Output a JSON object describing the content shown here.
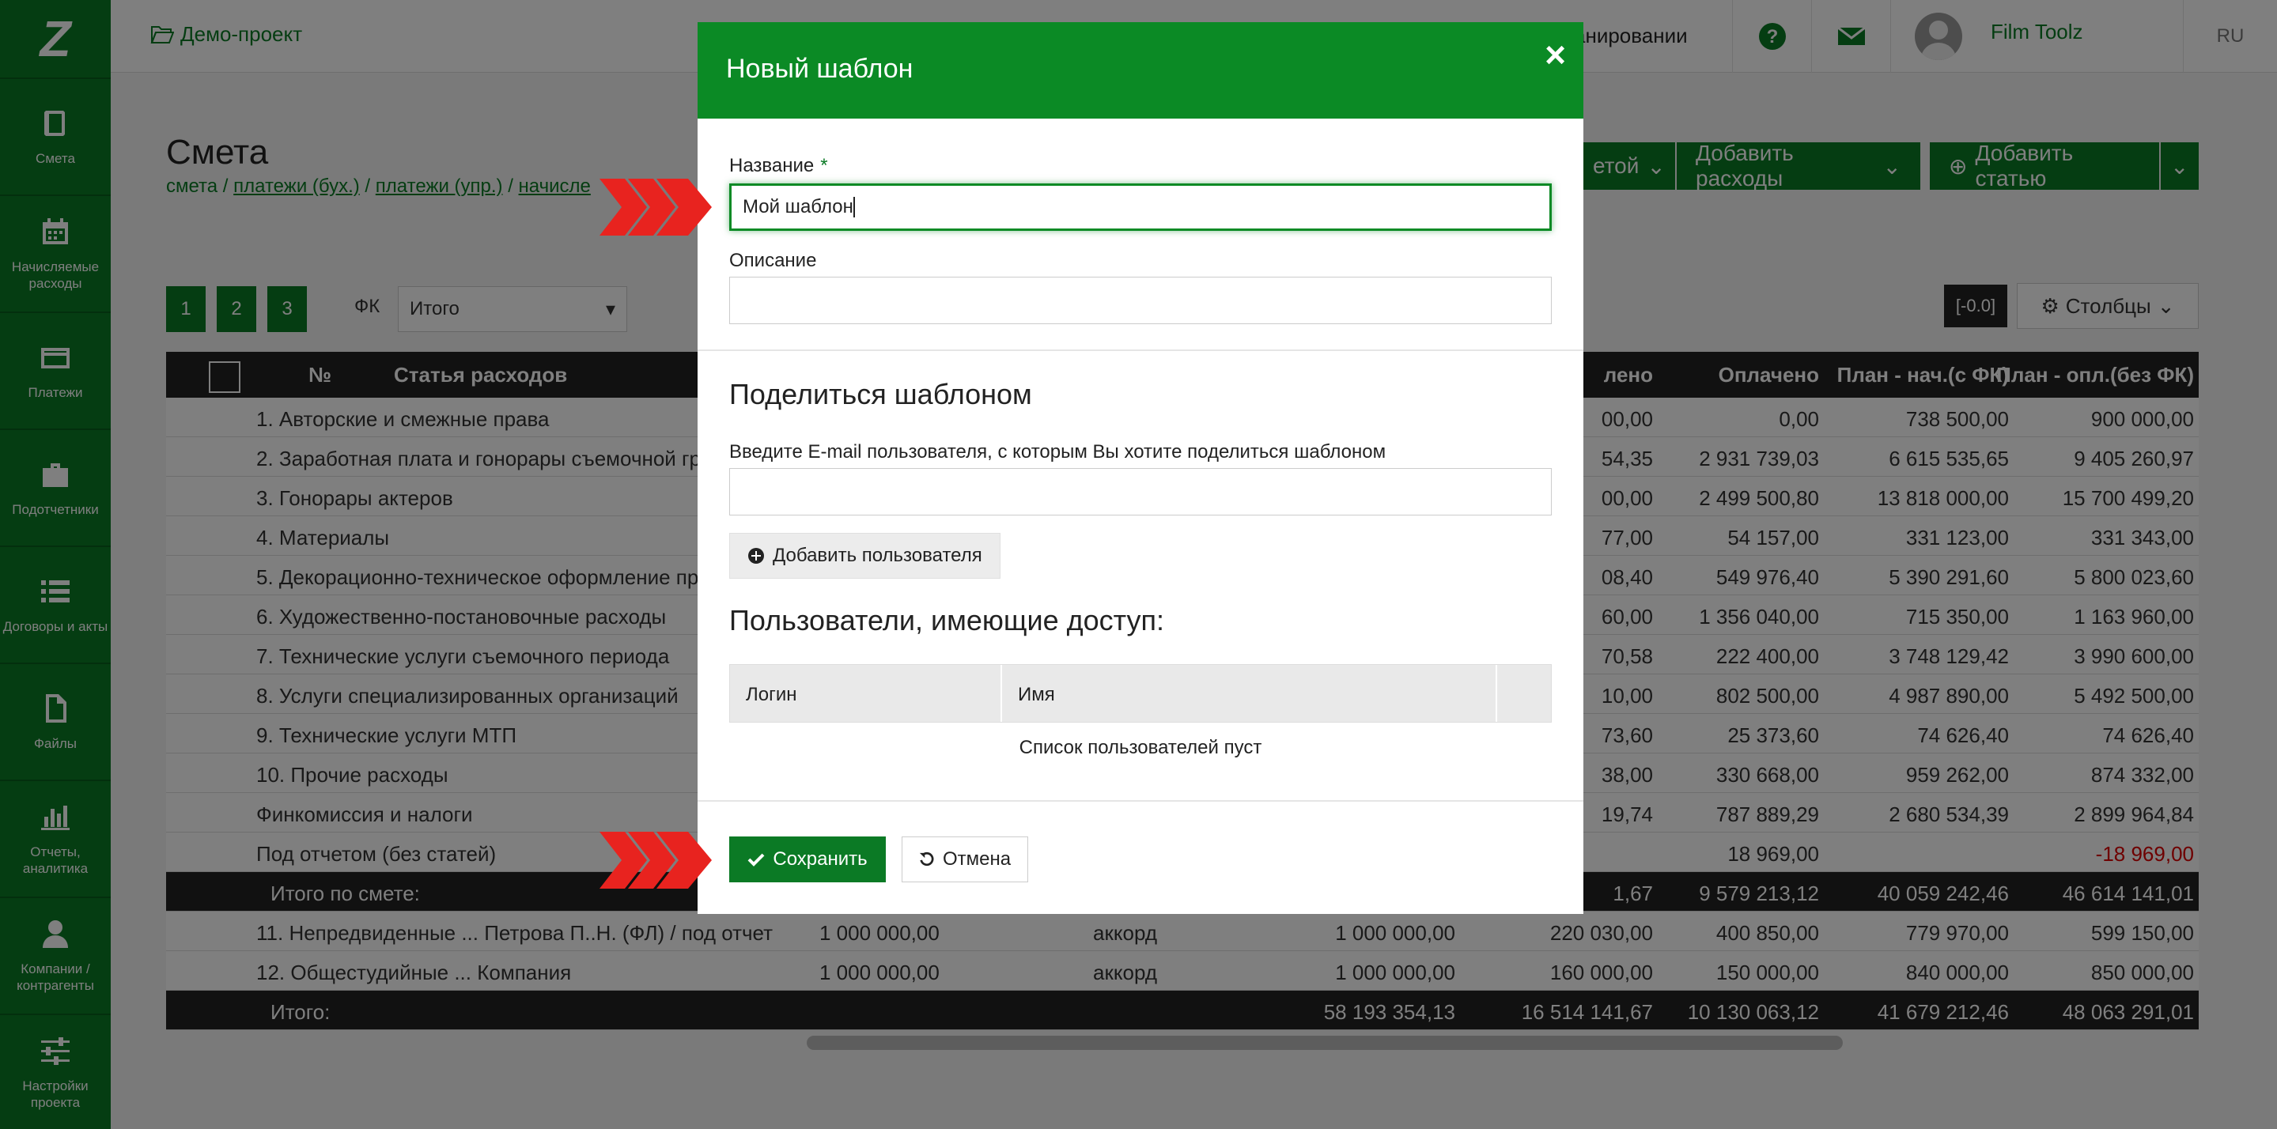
{
  "sidebar": {
    "logo": "Z",
    "items": [
      {
        "label": "Смета",
        "icon": "book-icon"
      },
      {
        "label": "Начисляемые расходы",
        "icon": "calendar-icon"
      },
      {
        "label": "Платежи",
        "icon": "card-icon"
      },
      {
        "label": "Подотчетники",
        "icon": "briefcase-icon"
      },
      {
        "label": "Договоры и акты",
        "icon": "list-icon"
      },
      {
        "label": "Файлы",
        "icon": "file-icon"
      },
      {
        "label": "Отчеты, аналитика",
        "icon": "bar-chart-icon"
      },
      {
        "label": "Компании / контрагенты",
        "icon": "user-icon"
      },
      {
        "label": "Настройки проекта",
        "icon": "sliders-icon"
      }
    ]
  },
  "topbar": {
    "project": "Демо-проект",
    "planning_fragment": "анировании",
    "user_name": "Film Toolz",
    "lang": "RU"
  },
  "page": {
    "title": "Смета",
    "breadcrumb": [
      "смета",
      "платежи (бух.)",
      "платежи (упр.)",
      "начисле"
    ],
    "buttons": {
      "statya_fragment": "етой",
      "add_expenses": "Добавить расходы",
      "add_article": "Добавить статью",
      "columns": "Столбцы"
    },
    "pager": [
      "1",
      "2",
      "3"
    ],
    "fk_label": "ФК",
    "fk_value": "Итого",
    "zoom": "[-0.0]"
  },
  "table": {
    "headers": {
      "num": "№",
      "article": "Статья расходов",
      "col1": "лено",
      "col2": "Оплачено",
      "col3": "План - нач.(с ФК)",
      "col4": "План - опл.(без ФК)"
    },
    "rows": [
      {
        "name": "1. Авторские и смежные права",
        "v1": "00,00",
        "v2": "0,00",
        "v3": "738 500,00",
        "v4": "900 000,00"
      },
      {
        "name": "2. Заработная плата и гонорары съемочной гр",
        "v1": "54,35",
        "v2": "2 931 739,03",
        "v3": "6 615 535,65",
        "v4": "9 405 260,97"
      },
      {
        "name": "3. Гонорары актеров",
        "v1": "00,00",
        "v2": "2 499 500,80",
        "v3": "13 818 000,00",
        "v4": "15 700 499,20"
      },
      {
        "name": "4. Материалы",
        "v1": "77,00",
        "v2": "54 157,00",
        "v3": "331 123,00",
        "v4": "331 343,00"
      },
      {
        "name": "5. Декорационно-техническое оформление пр",
        "v1": "08,40",
        "v2": "549 976,40",
        "v3": "5 390 291,60",
        "v4": "5 800 023,60"
      },
      {
        "name": "6. Художественно-постановочные расходы",
        "v1": "60,00",
        "v2": "1 356 040,00",
        "v3": "715 350,00",
        "v4": "1 163 960,00"
      },
      {
        "name": "7. Технические услуги съемочного периода",
        "v1": "70,58",
        "v2": "222 400,00",
        "v3": "3 748 129,42",
        "v4": "3 990 600,00"
      },
      {
        "name": "8. Услуги специализированных организаций",
        "v1": "10,00",
        "v2": "802 500,00",
        "v3": "4 987 890,00",
        "v4": "5 492 500,00"
      },
      {
        "name": "9. Технические услуги МТП",
        "v1": "73,60",
        "v2": "25 373,60",
        "v3": "74 626,40",
        "v4": "74 626,40"
      },
      {
        "name": "10. Прочие расходы",
        "v1": "38,00",
        "v2": "330 668,00",
        "v3": "959 262,00",
        "v4": "874 332,00"
      },
      {
        "name": "Финкомиссия и налоги",
        "v1": "19,74",
        "v2": "787 889,29",
        "v3": "2 680 534,39",
        "v4": "2 899 964,84"
      },
      {
        "name": "Под отчетом (без статей)",
        "v1": "",
        "v2": "18 969,00",
        "v3": "",
        "v4": "-18 969,00"
      }
    ],
    "subtotal": {
      "name": "Итого по смете:",
      "v1": "1,67",
      "v2": "9 579 213,12",
      "v3": "40 059 242,46",
      "v4": "46 614 141,01"
    },
    "extra_rows": [
      {
        "name": "11. Непредвиденные ... Петрова П..Н. (ФЛ) / под отчет",
        "a": "1 000 000,00",
        "type": "аккорд",
        "b": "1 000 000,00",
        "v1": "220 030,00",
        "v2": "400 850,00",
        "v3": "779 970,00",
        "v4": "599 150,00"
      },
      {
        "name": "12. Общестудийные ... Компания",
        "a": "1 000 000,00",
        "type": "аккорд",
        "b": "1 000 000,00",
        "v1": "160 000,00",
        "v2": "150 000,00",
        "v3": "840 000,00",
        "v4": "850 000,00"
      }
    ],
    "grand_total": {
      "name": "Итого:",
      "b": "58 193 354,13",
      "v1": "16 514 141,67",
      "v2": "10 130 063,12",
      "v3": "41 679 212,46",
      "v4": "48 063 291,01"
    }
  },
  "modal": {
    "title": "Новый шаблон",
    "close": "×",
    "name_label": "Название",
    "required_mark": "*",
    "name_value": "Мой шаблон",
    "desc_label": "Описание",
    "desc_value": "",
    "share_heading": "Поделиться шаблоном",
    "email_label": "Введите E-mail пользователя, с которым Вы хотите поделиться шаблоном",
    "email_value": "",
    "add_user": "Добавить пользователя",
    "access_heading": "Пользователи, имеющие доступ:",
    "col_login": "Логин",
    "col_name": "Имя",
    "empty_text": "Список пользователей пуст",
    "save": "Сохранить",
    "cancel": "Отмена"
  },
  "colors": {
    "brand": "#0b7a25",
    "header": "#0b8a25",
    "arrow": "#e8231f"
  }
}
